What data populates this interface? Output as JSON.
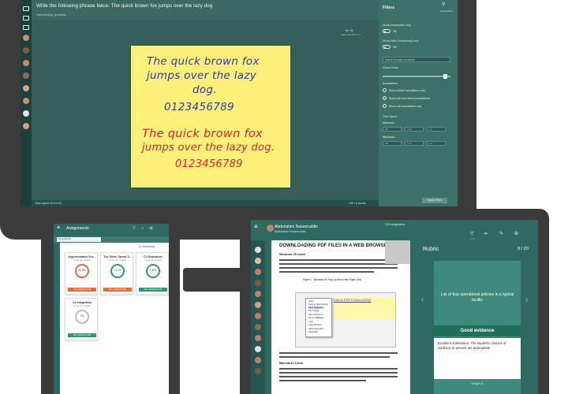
{
  "monitor": {
    "prompt": "Write the following phrase twice: The quick brown fox jumps over the lazy dog",
    "subtitle": "Handwriting Question",
    "tools": [
      "Insert tool",
      "Zoom in"
    ],
    "note": {
      "blue_lines": [
        "The quick brown fox",
        "jumps over the lazy",
        "dog.",
        "0123456789"
      ],
      "red_lines": [
        "The quick brown fox",
        "jumps over the lazy dog.",
        "0123456789"
      ]
    },
    "status_left": "Time spent: 00:13:15",
    "status_right": "199 / 6 words",
    "filters": {
      "title": "Filters",
      "reset": "Reset filters",
      "show_incomplete": "Show Incomplete Only",
      "show_incomplete_state": "Off",
      "show_with_comments": "Show With Comment(s) only",
      "show_with_comments_state": "Off",
      "search_placeholder": "Search through comments...",
      "gloss_grade": "Gloss Grade",
      "annotations": "Annotations",
      "radio": [
        "Show without annotations only",
        "Show with and without annotations",
        "Show with annotations only"
      ],
      "time_spent": "Time Spent",
      "minimum": "Minimum",
      "maximum": "Maximum",
      "time_units": [
        "h:h",
        "m:m",
        "s:s"
      ],
      "apply": "Apply Filters"
    }
  },
  "phone": {
    "title": "Assignments",
    "crumb": "All Students",
    "sort": "A: Ascending",
    "cards": [
      {
        "title": "Argumentative Ess...",
        "sub": "12 Apr 19 · English",
        "score": "51.3%",
        "date": "Due 14/03/19 5 PM",
        "color": "#e86a3a"
      },
      {
        "title": "The Silver Sword S...",
        "sub": "12 Apr 19 · English",
        "score": "71.1%",
        "date": "Due 14/03/19 5 PM",
        "color": "#2e9a6c"
      },
      {
        "title": "C2 Evaluation",
        "sub": "12 Apr 19 · English",
        "score": "100%",
        "date": "Due 14/03/19 5 PM",
        "color": "#2e9a6c"
      },
      {
        "title": "C2 Integration",
        "sub": "12 Apr 19 · English",
        "score": "0%",
        "date": "Due 14/03/19 5 PM",
        "color": "#2e9a6c"
      }
    ]
  },
  "tablet": {
    "header_center": "C2 Integration",
    "student": "Abdulrahim Naseeruddin",
    "student_sub": "Abdulrahim Naseeruddin",
    "doc": {
      "heading": "DOWNLOADING PDF FILES IN A WEB BROWSER",
      "section1": "Windows 95 Users",
      "caption": "Figure 1. Windows 95 Pop-Up Menu with Right Click",
      "link": "Link to PDF Format (121k)",
      "menu": [
        "Open",
        "Open in New Window",
        "Save Target As...",
        "Print Target",
        "Save Picture As...",
        "Set as Wallpaper",
        "Copy",
        "Copy Shortcut",
        "Add to Favorites...",
        "Properties"
      ],
      "section2": "Macintosh Users"
    },
    "rubric": {
      "title": "Rubric",
      "page": "8 / 20",
      "description": "List of four operational policies in a typical facility",
      "level": "Good evidence",
      "feedback": "Excellent submission. The student's choices of evidence to present are appropriate",
      "weight": "Weight: 8"
    }
  }
}
